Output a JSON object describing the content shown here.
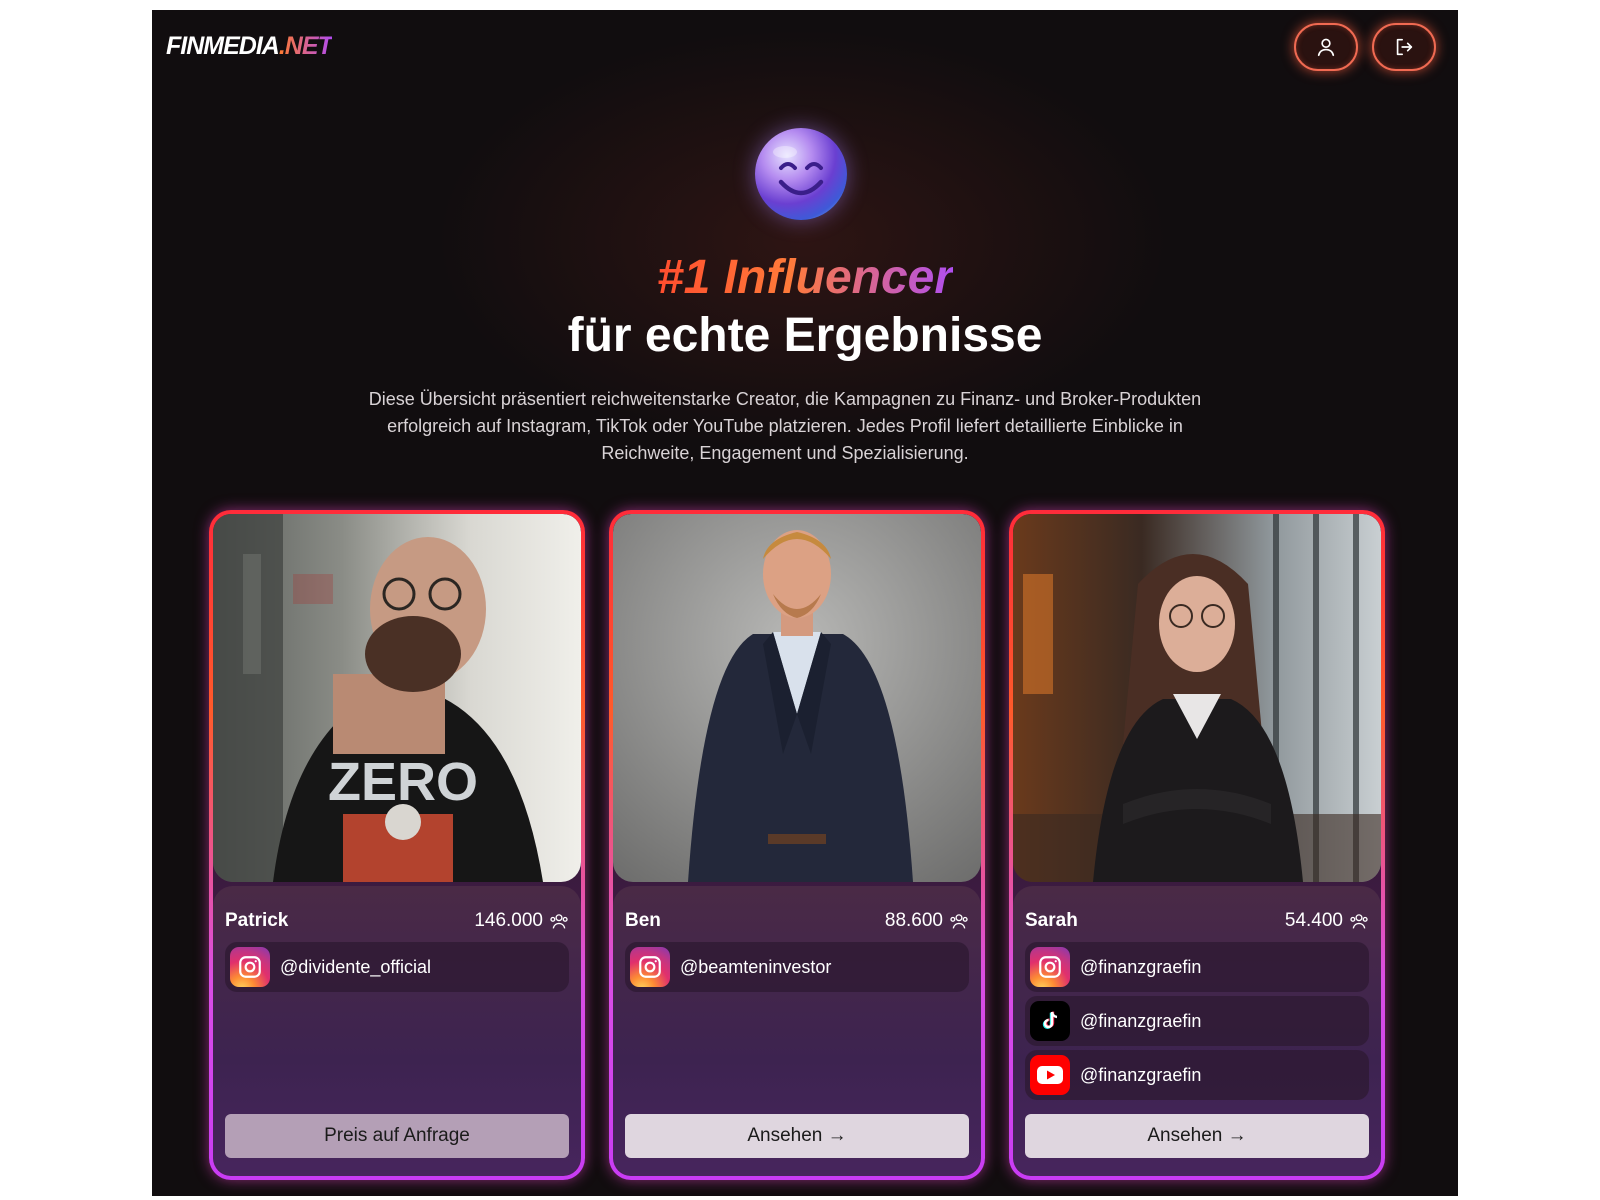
{
  "brand": {
    "name_main": "FINMEDIA",
    "name_suffix": ".NET"
  },
  "header": {
    "buttons": [
      {
        "icon": "user-icon"
      },
      {
        "icon": "logout-icon"
      }
    ]
  },
  "hero": {
    "emoji_icon": "smiling-face-orb-icon",
    "title_line1": "#1 Influencer",
    "title_line2": "für echte Ergebnisse",
    "description": "Diese Übersicht präsentiert reichweitenstarke Creator, die Kampagnen zu Finanz- und Broker-Produkten erfolgreich auf Instagram, TikTok oder YouTube platzieren. Jedes Profil liefert detaillierte Einblicke in Reichweite, Engagement und Spezialisierung."
  },
  "colors": {
    "accent_orange": "#ff5a2a",
    "accent_purple": "#c93cf5",
    "background": "#110d0f"
  },
  "influencers": [
    {
      "name": "Patrick",
      "followers": "146.000",
      "accounts": [
        {
          "platform": "instagram",
          "handle": "@dividente_official"
        }
      ],
      "cta_label": "Preis auf Anfrage"
    },
    {
      "name": "Ben",
      "followers": "88.600",
      "accounts": [
        {
          "platform": "instagram",
          "handle": "@beamteninvestor"
        }
      ],
      "cta_label": "Ansehen →"
    },
    {
      "name": "Sarah",
      "followers": "54.400",
      "accounts": [
        {
          "platform": "instagram",
          "handle": "@finanzgraefin"
        },
        {
          "platform": "tiktok",
          "handle": "@finanzgraefin"
        },
        {
          "platform": "youtube",
          "handle": "@finanzgraefin"
        }
      ],
      "cta_label": "Ansehen →"
    }
  ],
  "photo_text": {
    "shirt_print": "ZERO"
  }
}
